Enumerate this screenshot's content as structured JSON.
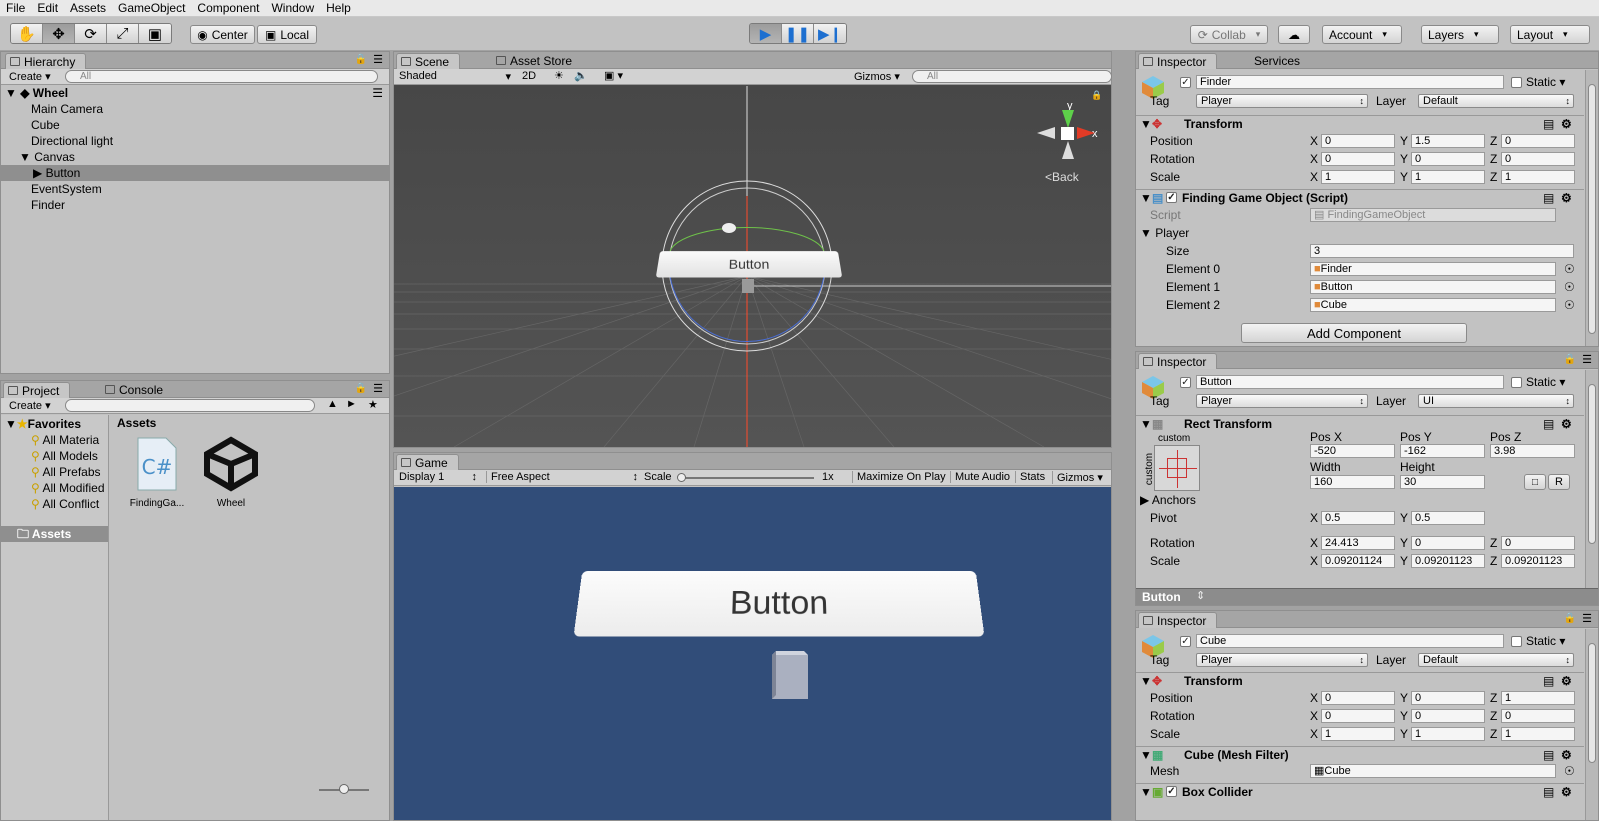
{
  "menu": [
    "File",
    "Edit",
    "Assets",
    "GameObject",
    "Component",
    "Window",
    "Help"
  ],
  "toolbar": {
    "center": "Center",
    "local": "Local",
    "collab": "Collab",
    "account": "Account",
    "layers": "Layers",
    "layout": "Layout",
    "play_color": "#3f8fd9"
  },
  "hierarchy": {
    "tab": "Hierarchy",
    "create": "Create",
    "search_placeholder": "All",
    "scene": "Wheel",
    "items": [
      {
        "label": "Main Camera"
      },
      {
        "label": "Cube"
      },
      {
        "label": "Directional light"
      },
      {
        "label": "Canvas"
      },
      {
        "label": "Button"
      },
      {
        "label": "EventSystem"
      },
      {
        "label": "Finder"
      }
    ]
  },
  "project": {
    "tab": "Project",
    "console_tab": "Console",
    "create": "Create",
    "favorites": "Favorites",
    "fav_items": [
      "All Materia",
      "All Models",
      "All Prefabs",
      "All Modified",
      "All Conflict"
    ],
    "assets_root": "Assets",
    "assets_header": "Assets",
    "assets": [
      {
        "label": "FindingGa...",
        "icon": "csharp-script-icon"
      },
      {
        "label": "Wheel",
        "icon": "unity-scene-icon"
      }
    ]
  },
  "scene": {
    "tab": "Scene",
    "asset_store_tab": "Asset Store",
    "shading": "Shaded",
    "mode2d": "2D",
    "gizmos": "Gizmos",
    "search_placeholder": "All",
    "button_text": "Button",
    "back_label": "Back",
    "gizmo_y": "y",
    "gizmo_x": "x"
  },
  "game": {
    "tab": "Game",
    "display": "Display 1",
    "aspect": "Free Aspect",
    "scale_label": "Scale",
    "scale_value": "1x",
    "maximize": "Maximize On Play",
    "mute": "Mute Audio",
    "stats": "Stats",
    "gizmos": "Gizmos",
    "button_text": "Button",
    "bg_color": "#314d79"
  },
  "inspector1": {
    "tab": "Inspector",
    "services_tab": "Services",
    "name": "Finder",
    "static": "Static",
    "tag_label": "Tag",
    "tag": "Player",
    "layer_label": "Layer",
    "layer": "Default",
    "transform": {
      "title": "Transform",
      "position": {
        "label": "Position",
        "x": "0",
        "y": "1.5",
        "z": "0"
      },
      "rotation": {
        "label": "Rotation",
        "x": "0",
        "y": "0",
        "z": "0"
      },
      "scale": {
        "label": "Scale",
        "x": "1",
        "y": "1",
        "z": "1"
      }
    },
    "script_comp": {
      "title": "Finding Game Object (Script)",
      "script_label": "Script",
      "script": "FindingGameObject",
      "player_label": "Player",
      "size_label": "Size",
      "size": "3",
      "elements": [
        {
          "label": "Element 0",
          "value": "Finder"
        },
        {
          "label": "Element 1",
          "value": "Button"
        },
        {
          "label": "Element 2",
          "value": "Cube"
        }
      ]
    },
    "add_component": "Add Component"
  },
  "inspector2": {
    "tab": "Inspector",
    "name": "Button",
    "static": "Static",
    "tag_label": "Tag",
    "tag": "Player",
    "layer_label": "Layer",
    "layer": "UI",
    "rect": {
      "title": "Rect Transform",
      "anchor_label": "custom",
      "side_label": "custom",
      "posx_label": "Pos X",
      "posy_label": "Pos Y",
      "posz_label": "Pos Z",
      "posx": "-520",
      "posy": "-162",
      "posz": "3.98",
      "width_label": "Width",
      "height_label": "Height",
      "width": "160",
      "height": "30",
      "r_btn": "R",
      "anchors_label": "Anchors",
      "pivot": {
        "label": "Pivot",
        "x": "0.5",
        "y": "0.5"
      },
      "rotation": {
        "label": "Rotation",
        "x": "24.413",
        "y": "0",
        "z": "0"
      },
      "scale": {
        "label": "Scale",
        "x": "0.09201124",
        "y": "0.09201123",
        "z": "0.09201123"
      }
    },
    "footer": "Button"
  },
  "inspector3": {
    "tab": "Inspector",
    "name": "Cube",
    "static": "Static",
    "tag_label": "Tag",
    "tag": "Player",
    "layer_label": "Layer",
    "layer": "Default",
    "transform": {
      "title": "Transform",
      "position": {
        "label": "Position",
        "x": "0",
        "y": "0",
        "z": "1"
      },
      "rotation": {
        "label": "Rotation",
        "x": "0",
        "y": "0",
        "z": "0"
      },
      "scale": {
        "label": "Scale",
        "x": "1",
        "y": "1",
        "z": "1"
      }
    },
    "mesh": {
      "title": "Cube (Mesh Filter)",
      "mesh_label": "Mesh",
      "mesh": "Cube"
    },
    "collider": {
      "title": "Box Collider"
    }
  }
}
